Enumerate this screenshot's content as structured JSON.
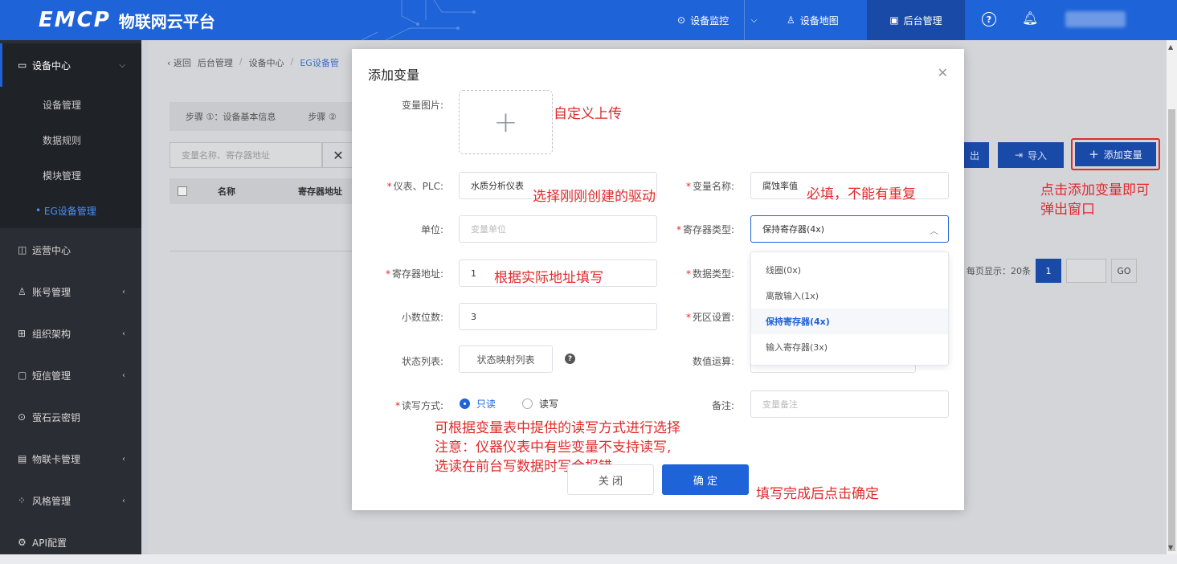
{
  "topbar": {
    "brand": "EMCP",
    "subtitle": "物联网云平台",
    "nav_monitor": "设备监控",
    "nav_map": "设备地图",
    "nav_backend": "后台管理"
  },
  "sidebar": {
    "device_center": "设备中心",
    "sub_items": [
      "设备管理",
      "数据规则",
      "模块管理",
      "EG设备管理"
    ],
    "groups": [
      "运营中心",
      "账号管理",
      "组织架构",
      "短信管理",
      "萤石云密钥",
      "物联卡管理",
      "风格管理",
      "API配置"
    ]
  },
  "breadcrumb": {
    "back": "返回",
    "items": [
      "后台管理",
      "设备中心",
      "EG设备管"
    ]
  },
  "page": {
    "step1": "步骤 ①：设备基本信息",
    "step2": "步骤 ②",
    "search_placeholder": "变量名称、寄存器地址",
    "col_name": "名称",
    "col_register": "寄存器地址",
    "btn_export": "出",
    "btn_import": "导入",
    "btn_add": "添加变量",
    "pager_label": "每页显示：20条",
    "pager_page": "1",
    "pager_go": "GO"
  },
  "modal": {
    "title": "添加变量",
    "labels": {
      "image": "变量图片:",
      "instrument": "仪表、PLC:",
      "var_name": "变量名称:",
      "unit": "单位:",
      "register_type": "寄存器类型:",
      "register_addr": "寄存器地址:",
      "data_type": "数据类型:",
      "decimals": "小数位数:",
      "deadband": "死区设置:",
      "state_list": "状态列表:",
      "calc": "数值运算:",
      "rw_mode": "读写方式:",
      "remark": "备注:"
    },
    "values": {
      "instrument": "水质分析仪表",
      "var_name": "腐蚀率值",
      "unit_placeholder": "变量单位",
      "register_type": "保持寄存器(4x)",
      "register_addr": "1",
      "decimals": "3",
      "state_button": "状态映射列表",
      "remark_placeholder": "变量备注"
    },
    "rw_options": [
      "只读",
      "读写"
    ],
    "dropdown_options": [
      "线圈(0x)",
      "离散输入(1x)",
      "保持寄存器(4x)",
      "输入寄存器(3x)"
    ],
    "btn_cancel": "关 闭",
    "btn_ok": "确 定"
  },
  "annotations": {
    "upload": "自定义上传",
    "instrument": "选择刚刚创建的驱动",
    "var_name": "必填，不能有重复",
    "register_addr": "根据实际地址填写",
    "add_button_1": "点击添加变量即可",
    "add_button_2": "弹出窗口",
    "rw_1": "可根据变量表中提供的读写方式进行选择",
    "rw_2": "注意：仪器仪表中有些变量不支持读写,",
    "rw_3": "选读在前台写数据时写会报错",
    "confirm": "填写完成后点击确定"
  }
}
